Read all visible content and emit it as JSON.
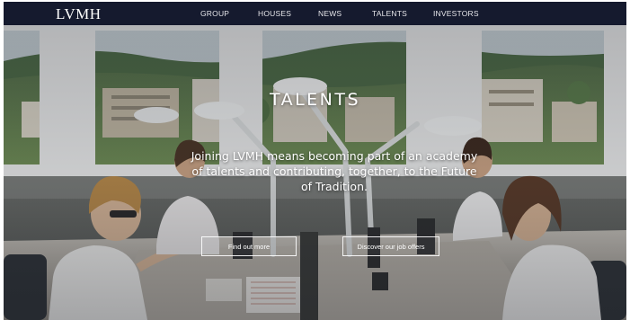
{
  "header": {
    "logo": "LVMH",
    "nav": [
      {
        "label": "GROUP"
      },
      {
        "label": "HOUSES"
      },
      {
        "label": "NEWS"
      },
      {
        "label": "TALENTS"
      },
      {
        "label": "INVESTORS"
      }
    ]
  },
  "hero": {
    "title": "TALENTS",
    "description": "Joining LVMH means becoming part of an academy of talents and contributing, together, to the Future of Tradition.",
    "buttons": [
      {
        "label": "Find out more"
      },
      {
        "label": "Discover our job offers"
      }
    ]
  },
  "colors": {
    "nav_background": "#151a2e",
    "text_light": "#ffffff"
  }
}
